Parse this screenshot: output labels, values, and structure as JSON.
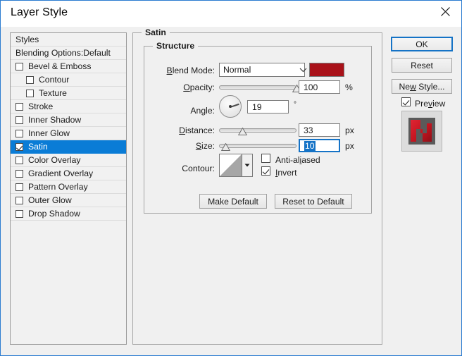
{
  "window": {
    "title": "Layer Style",
    "close_icon": "close-icon"
  },
  "sidebar": {
    "items": [
      {
        "label": "Styles",
        "type": "header",
        "checkbox": false,
        "checked": false,
        "indent": false,
        "selected": false
      },
      {
        "label": "Blending Options:Default",
        "type": "header",
        "checkbox": false,
        "checked": false,
        "indent": false,
        "selected": false
      },
      {
        "label": "Bevel & Emboss",
        "type": "effect",
        "checkbox": true,
        "checked": false,
        "indent": false,
        "selected": false
      },
      {
        "label": "Contour",
        "type": "effect",
        "checkbox": true,
        "checked": false,
        "indent": true,
        "selected": false
      },
      {
        "label": "Texture",
        "type": "effect",
        "checkbox": true,
        "checked": false,
        "indent": true,
        "selected": false
      },
      {
        "label": "Stroke",
        "type": "effect",
        "checkbox": true,
        "checked": false,
        "indent": false,
        "selected": false
      },
      {
        "label": "Inner Shadow",
        "type": "effect",
        "checkbox": true,
        "checked": false,
        "indent": false,
        "selected": false
      },
      {
        "label": "Inner Glow",
        "type": "effect",
        "checkbox": true,
        "checked": false,
        "indent": false,
        "selected": false
      },
      {
        "label": "Satin",
        "type": "effect",
        "checkbox": true,
        "checked": true,
        "indent": false,
        "selected": true
      },
      {
        "label": "Color Overlay",
        "type": "effect",
        "checkbox": true,
        "checked": false,
        "indent": false,
        "selected": false
      },
      {
        "label": "Gradient Overlay",
        "type": "effect",
        "checkbox": true,
        "checked": false,
        "indent": false,
        "selected": false
      },
      {
        "label": "Pattern Overlay",
        "type": "effect",
        "checkbox": true,
        "checked": false,
        "indent": false,
        "selected": false
      },
      {
        "label": "Outer Glow",
        "type": "effect",
        "checkbox": true,
        "checked": false,
        "indent": false,
        "selected": false
      },
      {
        "label": "Drop Shadow",
        "type": "effect",
        "checkbox": true,
        "checked": false,
        "indent": false,
        "selected": false
      }
    ]
  },
  "main": {
    "group_legend": "Satin",
    "structure_legend": "Structure",
    "blend_mode": {
      "label": "Blend Mode:",
      "value": "Normal",
      "dropdown_icon": "chevron-down-icon",
      "color": "#a91219"
    },
    "opacity": {
      "label": "Opacity:",
      "value": "100",
      "unit": "%",
      "slider_percent": 100
    },
    "angle": {
      "label": "Angle:",
      "value": "19",
      "unit": "°",
      "degrees": 19
    },
    "distance": {
      "label": "Distance:",
      "value": "33",
      "unit": "px",
      "slider_percent": 30
    },
    "size": {
      "label": "Size:",
      "value": "10",
      "unit": "px",
      "slider_percent": 8,
      "focused": true
    },
    "contour": {
      "label": "Contour:",
      "dropdown_icon": "contour-dropdown-icon"
    },
    "anti_aliased": {
      "label": "Anti-aliased",
      "checked": false
    },
    "invert": {
      "label": "Invert",
      "checked": true
    },
    "make_default": "Make Default",
    "reset_to_default": "Reset to Default"
  },
  "right": {
    "ok": "OK",
    "reset": "Reset",
    "new_style": "New Style...",
    "preview": {
      "label": "Preview",
      "checked": true
    },
    "thumbnail": {
      "background": "#5a5a5a",
      "shape_color": "#cc1122"
    }
  }
}
